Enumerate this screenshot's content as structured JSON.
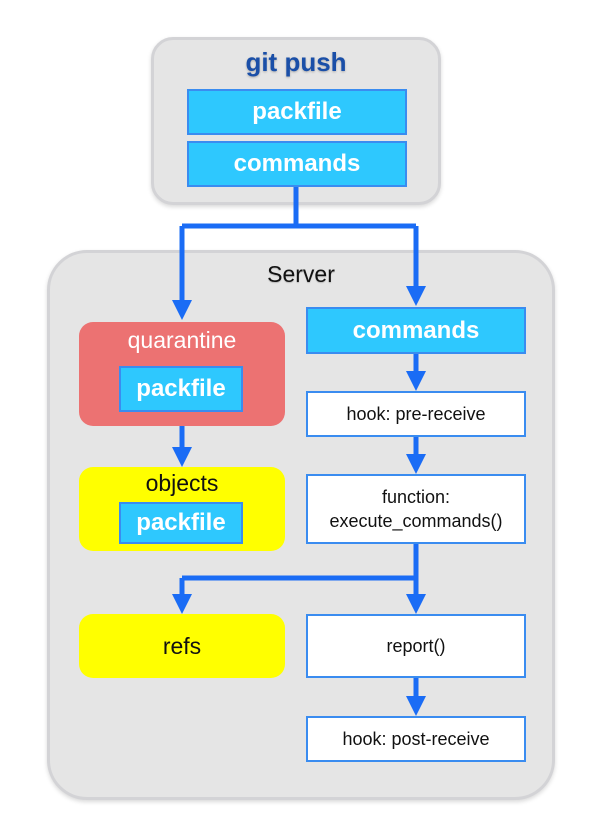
{
  "client": {
    "title": "git push",
    "items": [
      "packfile",
      "commands"
    ]
  },
  "server": {
    "title": "Server",
    "quarantine": {
      "label": "quarantine",
      "item": "packfile"
    },
    "objects": {
      "label": "objects",
      "item": "packfile"
    },
    "refs": {
      "label": "refs"
    },
    "commands": "commands",
    "pre_receive": "hook: pre-receive",
    "execute": {
      "line1": "function:",
      "line2": "execute_commands()"
    },
    "report": "report()",
    "post_receive": "hook: post-receive"
  },
  "colors": {
    "arrow": "#1a6cf5",
    "cyan_box": "#2ec8fe",
    "quarantine": "#ec7272",
    "highlight_yellow": "#ffff00",
    "title_blue": "#1a4fa8"
  }
}
